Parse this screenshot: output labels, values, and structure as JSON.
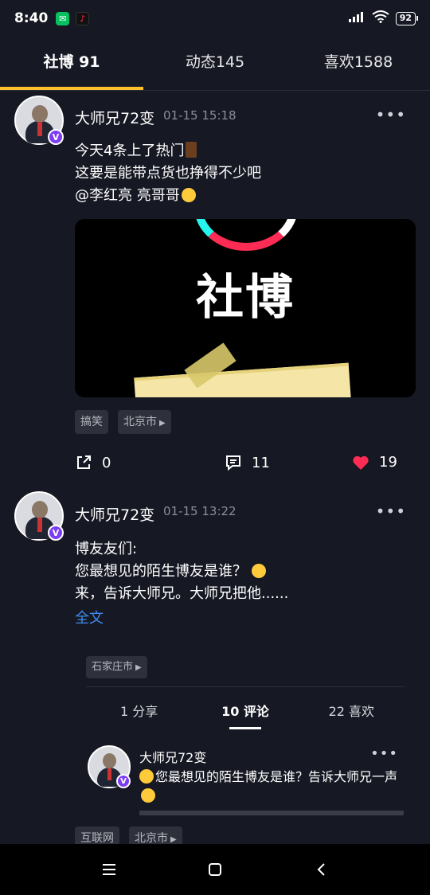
{
  "status_bar": {
    "time": "8:40",
    "app_icons": [
      "wechat-icon",
      "tiktok-icon"
    ],
    "battery": "92"
  },
  "tabs": [
    {
      "label": "社博 91",
      "active": true
    },
    {
      "label": "动态145",
      "active": false
    },
    {
      "label": "喜欢1588",
      "active": false
    }
  ],
  "posts": [
    {
      "author": "大师兄72变",
      "time": "01-15 15:18",
      "lines": [
        "今天4条上了热门",
        "这要是能带点货也挣得不少吧",
        "@李红亮 亮哥哥"
      ],
      "media": {
        "text": "社博"
      },
      "tags": [
        "搞笑",
        "北京市"
      ],
      "shares": "0",
      "comments": "11",
      "likes": "19"
    },
    {
      "author": "大师兄72变",
      "time": "01-15 13:22",
      "lines": [
        "博友友们:",
        "您最想见的陌生博友是谁？",
        "来，告诉大师兄。大师兄把他......"
      ],
      "full_text_link": "全文",
      "location_tag": "石家庄市",
      "sub_tabs": [
        {
          "label": "1 分享",
          "active": false
        },
        {
          "label": "10 评论",
          "active": true
        },
        {
          "label": "22 喜欢",
          "active": false
        }
      ],
      "comment": {
        "author": "大师兄72变",
        "text": "您最想见的陌生博友是谁？告诉大师兄一声"
      },
      "tags": [
        "互联网",
        "北京市"
      ]
    }
  ],
  "colors": {
    "background": "#161823",
    "accent": "#fdc12d",
    "like": "#fe2c55",
    "link": "#3e8df0"
  }
}
